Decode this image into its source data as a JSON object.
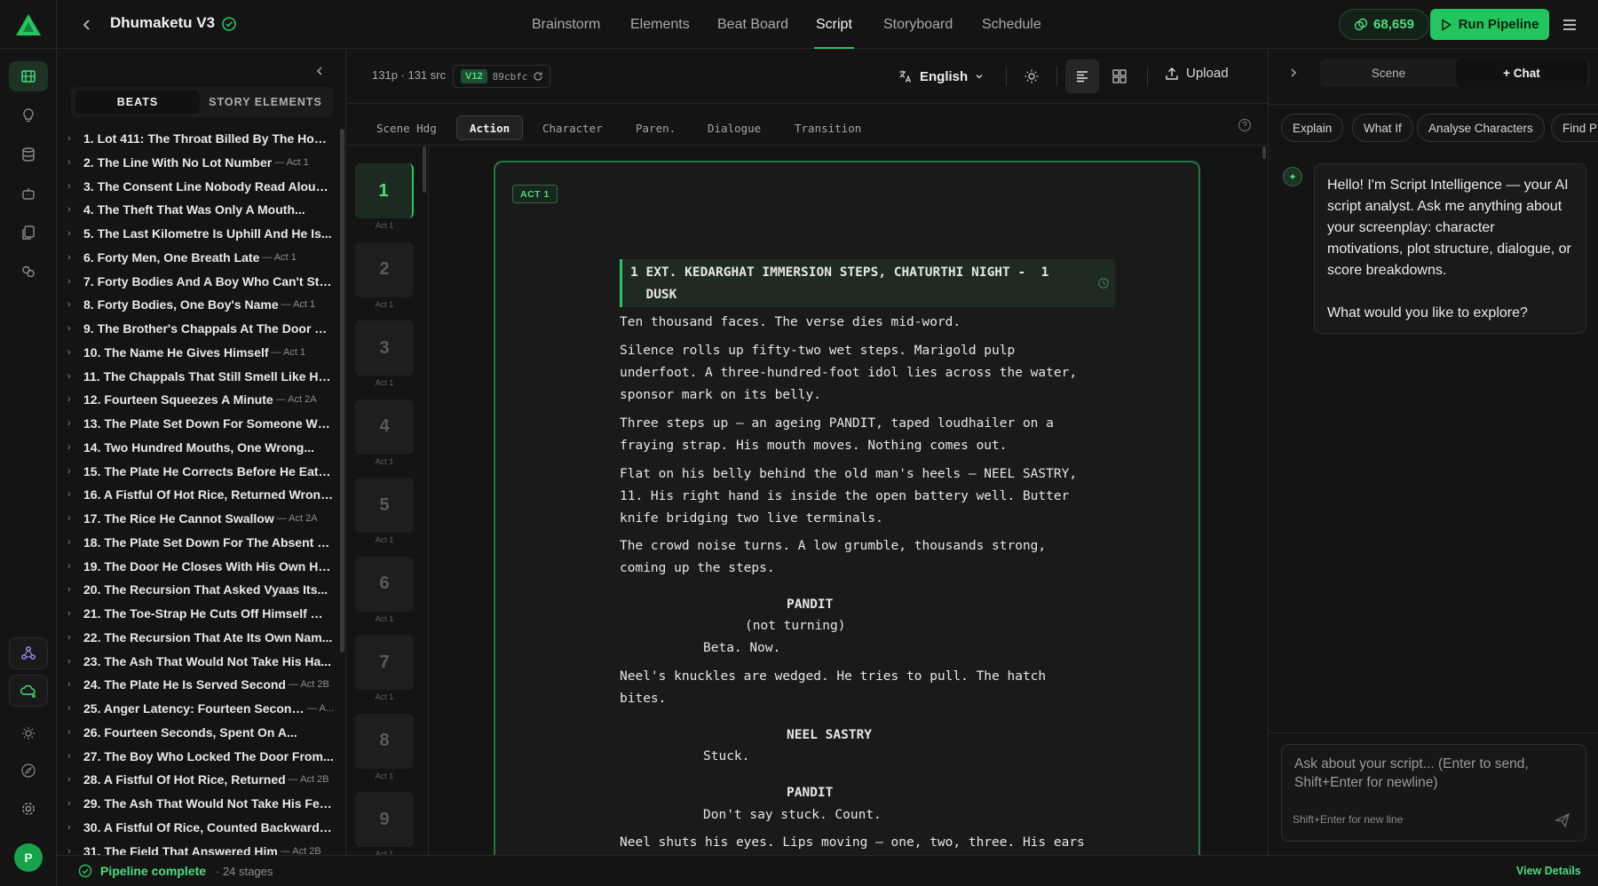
{
  "header": {
    "project_title": "Dhumaketu V3",
    "tabs": [
      "Brainstorm",
      "Elements",
      "Beat Board",
      "Script",
      "Storyboard",
      "Schedule"
    ],
    "active_tab": "Script",
    "credits": "68,659",
    "run_pipeline_label": "Run Pipeline"
  },
  "beats_panel": {
    "tabs": [
      "BEATS",
      "STORY ELEMENTS"
    ],
    "active_tab": "BEATS",
    "items": [
      {
        "title": "1. Lot 411: The Throat Billed By The Hour ...",
        "act": ""
      },
      {
        "title": "2. The Line With No Lot Number",
        "act": "— Act 1"
      },
      {
        "title": "3. The Consent Line Nobody Read Aloud ...",
        "act": ""
      },
      {
        "title": "4. The Theft That Was Only A Mouth...",
        "act": ""
      },
      {
        "title": "5. The Last Kilometre Is Uphill And He Is...",
        "act": ""
      },
      {
        "title": "6. Forty Men, One Breath Late",
        "act": "— Act 1"
      },
      {
        "title": "7. Forty Bodies And A Boy Who Can't Sto...",
        "act": ""
      },
      {
        "title": "8. Forty Bodies, One Boy's Name",
        "act": "— Act 1"
      },
      {
        "title": "9. The Brother's Chappals At The Door —...",
        "act": ""
      },
      {
        "title": "10. The Name He Gives Himself",
        "act": "— Act 1"
      },
      {
        "title": "11. The Chappals That Still Smell Like Him...",
        "act": ""
      },
      {
        "title": "12. Fourteen Squeezes A Minute",
        "act": "— Act 2A"
      },
      {
        "title": "13. The Plate Set Down For Someone Wh...",
        "act": ""
      },
      {
        "title": "14. Two Hundred Mouths, One Wrong...",
        "act": ""
      },
      {
        "title": "15. The Plate He Corrects Before He Eats I...",
        "act": ""
      },
      {
        "title": "16. A Fistful Of Hot Rice, Returned Wrong ...",
        "act": ""
      },
      {
        "title": "17. The Rice He Cannot Swallow",
        "act": "— Act 2A"
      },
      {
        "title": "18. The Plate Set Down For The Absent —...",
        "act": ""
      },
      {
        "title": "19. The Door He Closes With His Own Ha...",
        "act": ""
      },
      {
        "title": "20. The Recursion That Asked Vyaas Its...",
        "act": ""
      },
      {
        "title": "21. The Toe-Strap He Cuts Off Himself — ...",
        "act": ""
      },
      {
        "title": "22. The Recursion That Ate Its Own Nam...",
        "act": ""
      },
      {
        "title": "23. The Ash That Would Not Take His Ha...",
        "act": ""
      },
      {
        "title": "24. The Plate He Is Served Second",
        "act": "— Act 2B"
      },
      {
        "title": "25. Anger Latency: Fourteen Seconds",
        "act": "— A..."
      },
      {
        "title": "26. Fourteen Seconds, Spent On A...",
        "act": ""
      },
      {
        "title": "27. The Boy Who Locked The Door From...",
        "act": ""
      },
      {
        "title": "28. A Fistful Of Hot Rice, Returned",
        "act": "— Act 2B"
      },
      {
        "title": "29. The Ash That Would Not Take His Fee...",
        "act": ""
      },
      {
        "title": "30. A Fistful Of Rice, Counted Backwards ...",
        "act": ""
      },
      {
        "title": "31. The Field That Answered Him",
        "act": "— Act 2B"
      }
    ]
  },
  "editor": {
    "page_count": "131p · 131 src",
    "version": "V12",
    "hash": "89cbfc",
    "language": "English",
    "upload_label": "Upload",
    "elements": [
      "Scene Hdg",
      "Action",
      "Character",
      "Paren.",
      "Dialogue",
      "Transition"
    ],
    "active_element": "Action",
    "pages": [
      {
        "num": "1",
        "act": "Act 1"
      },
      {
        "num": "2",
        "act": "Act 1"
      },
      {
        "num": "3",
        "act": "Act 1"
      },
      {
        "num": "4",
        "act": "Act 1"
      },
      {
        "num": "5",
        "act": "Act 1"
      },
      {
        "num": "6",
        "act": "Act 1"
      },
      {
        "num": "7",
        "act": "Act 1"
      },
      {
        "num": "8",
        "act": "Act 1"
      },
      {
        "num": "9",
        "act": "Act 1"
      }
    ],
    "act_badge": "ACT 1",
    "scene_heading": [
      "1 EXT. KEDARGHAT IMMERSION STEPS, CHATURTHI NIGHT -  1",
      "  DUSK"
    ],
    "lines": {
      "a1": "Ten thousand faces. The verse dies mid-word.",
      "a2": "Silence rolls up fifty-two wet steps. Marigold pulp\nunderfoot. A three-hundred-foot idol lies across the water,\nsponsor mark on its belly.",
      "a3": "Three steps up — an ageing PANDIT, taped loudhailer on a\nfraying strap. His mouth moves. Nothing comes out.",
      "a4": "Flat on his belly behind the old man's heels — NEEL SASTRY,\n11. His right hand is inside the open battery well. Butter\nknife bridging two live terminals.",
      "a5": "The crowd noise turns. A low grumble, thousands strong,\ncoming up the steps.",
      "c1": "PANDIT",
      "p1": "(not turning)",
      "d1": "Beta. Now.",
      "a6": "Neel's knuckles are wedged. He tries to pull. The hatch\nbites.",
      "c2": "NEEL SASTRY",
      "d2": "Stuck.",
      "c3": "PANDIT",
      "d3": "Don't say stuck. Count.",
      "a7": "Neel shuts his eyes. Lips moving — one, two, three. His ears"
    }
  },
  "right_panel": {
    "tabs": [
      "Scene",
      "+ Chat"
    ],
    "active_tab": "+ Chat",
    "chips": [
      "Explain",
      "What If",
      "Analyse Characters",
      "Find P"
    ],
    "ai_message_1": "Hello! I'm Script Intelligence — your AI script analyst. Ask me anything about your screenplay: character motivations, plot structure, dialogue, or score breakdowns.",
    "ai_message_2": "What would you like to explore?",
    "input_placeholder": "Ask about your script... (Enter to send, Shift+Enter for newline)",
    "input_hint": "Shift+Enter for new line"
  },
  "status": {
    "text": "Pipeline complete",
    "stages": "· 24 stages",
    "view_details": "View Details"
  },
  "user": {
    "initial": "P"
  },
  "colors": {
    "accent": "#22c55e",
    "background": "#141414",
    "panel": "#1a1a1a"
  }
}
